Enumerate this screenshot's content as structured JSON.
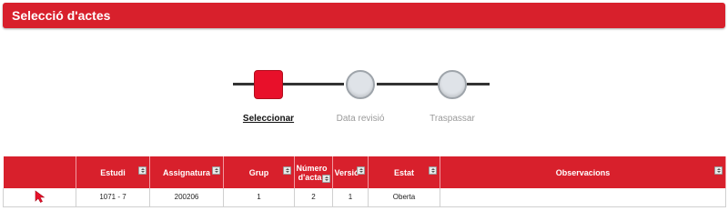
{
  "header": {
    "title": "Selecció d'actes"
  },
  "stepper": {
    "steps": [
      {
        "label": "Seleccionar",
        "state": "active"
      },
      {
        "label": "Data revisió",
        "state": "inactive"
      },
      {
        "label": "Traspassar",
        "state": "inactive"
      }
    ],
    "colors": {
      "active": "#e8102a",
      "inactive": "#dfe3e8",
      "accent": "#d8202c"
    }
  },
  "table": {
    "columns": [
      {
        "label": ""
      },
      {
        "label": "Estudi"
      },
      {
        "label": "Assignatura"
      },
      {
        "label": "Grup"
      },
      {
        "label": "Número d'acta"
      },
      {
        "label": "Versió"
      },
      {
        "label": "Estat"
      },
      {
        "label": "Observacions"
      }
    ],
    "rows": [
      {
        "pointer_icon": "cursor-arrow-icon",
        "estudi": "1071 - 7",
        "assignatura": "200206",
        "grup": "1",
        "numero_acta": "2",
        "versio": "1",
        "estat": "Oberta",
        "observacions": ""
      }
    ]
  }
}
